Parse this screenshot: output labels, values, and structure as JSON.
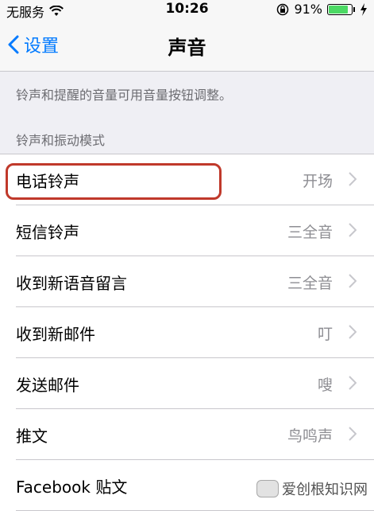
{
  "status": {
    "carrier": "无服务",
    "time": "10:26",
    "battery_percent": "91%",
    "battery_level": 0.91,
    "icons": [
      "wifi-icon",
      "orientation-lock-icon",
      "battery-icon",
      "charging-icon"
    ]
  },
  "nav": {
    "back_label": "设置",
    "title": "声音"
  },
  "hint": "铃声和提醒的音量可用音量按钮调整。",
  "section_header": "铃声和振动模式",
  "rows": [
    {
      "label": "电话铃声",
      "value": "开场"
    },
    {
      "label": "短信铃声",
      "value": "三全音"
    },
    {
      "label": "收到新语音留言",
      "value": "三全音"
    },
    {
      "label": "收到新邮件",
      "value": "叮"
    },
    {
      "label": "发送邮件",
      "value": "嗖"
    },
    {
      "label": "推文",
      "value": "鸟鸣声"
    },
    {
      "label": "Facebook 贴文",
      "value": ""
    }
  ],
  "watermark": "爱创根知识网",
  "colors": {
    "accent": "#007aff",
    "highlight": "#c0392b",
    "battery": "#4cd964"
  }
}
